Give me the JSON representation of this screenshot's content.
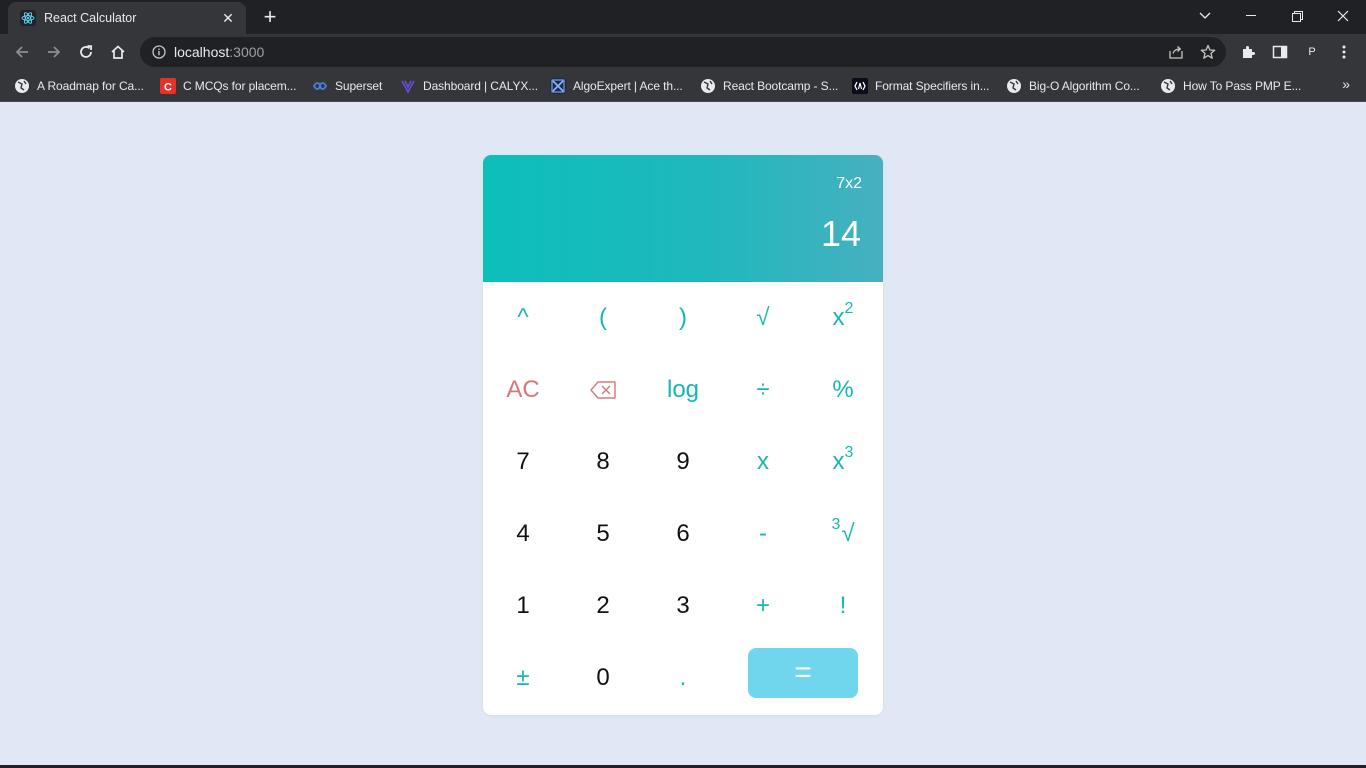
{
  "browser": {
    "tab_title": "React Calculator",
    "url_host": "localhost",
    "url_port": ":3000",
    "profile_initial": "P",
    "bookmarks": [
      {
        "label": "A Roadmap for Ca...",
        "icon": "globe-icon"
      },
      {
        "label": "C MCQs for placem...",
        "icon": "c-logo-icon"
      },
      {
        "label": "Superset",
        "icon": "superset-icon"
      },
      {
        "label": "Dashboard | CALYX...",
        "icon": "calyx-icon"
      },
      {
        "label": "AlgoExpert | Ace th...",
        "icon": "algoexpert-icon"
      },
      {
        "label": "React Bootcamp - S...",
        "icon": "globe-icon"
      },
      {
        "label": "Format Specifiers in...",
        "icon": "format-icon"
      },
      {
        "label": "Big-O Algorithm Co...",
        "icon": "globe-icon"
      },
      {
        "label": "How To Pass PMP E...",
        "icon": "globe-icon"
      }
    ]
  },
  "calculator": {
    "expression": "7x2",
    "result": "14",
    "keys": {
      "power": "^",
      "open_paren": "(",
      "close_paren": ")",
      "sqrt": "√",
      "square_base": "x",
      "square_exp": "2",
      "clear": "AC",
      "backspace": "⌫",
      "log": "log",
      "divide": "÷",
      "percent": "%",
      "seven": "7",
      "eight": "8",
      "nine": "9",
      "multiply": "x",
      "cube_base": "x",
      "cube_exp": "3",
      "four": "4",
      "five": "5",
      "six": "6",
      "minus": "-",
      "cbrt_index": "3",
      "cbrt_sign": "√",
      "one": "1",
      "two": "2",
      "three": "3",
      "plus": "+",
      "factorial": "!",
      "plus_minus": "±",
      "zero": "0",
      "decimal": ".",
      "equals": "="
    }
  },
  "colors": {
    "accent": "#14b8b3",
    "danger": "#d4787d",
    "equals_bg": "#6fd6ee",
    "page_bg": "#dfe8f4"
  }
}
